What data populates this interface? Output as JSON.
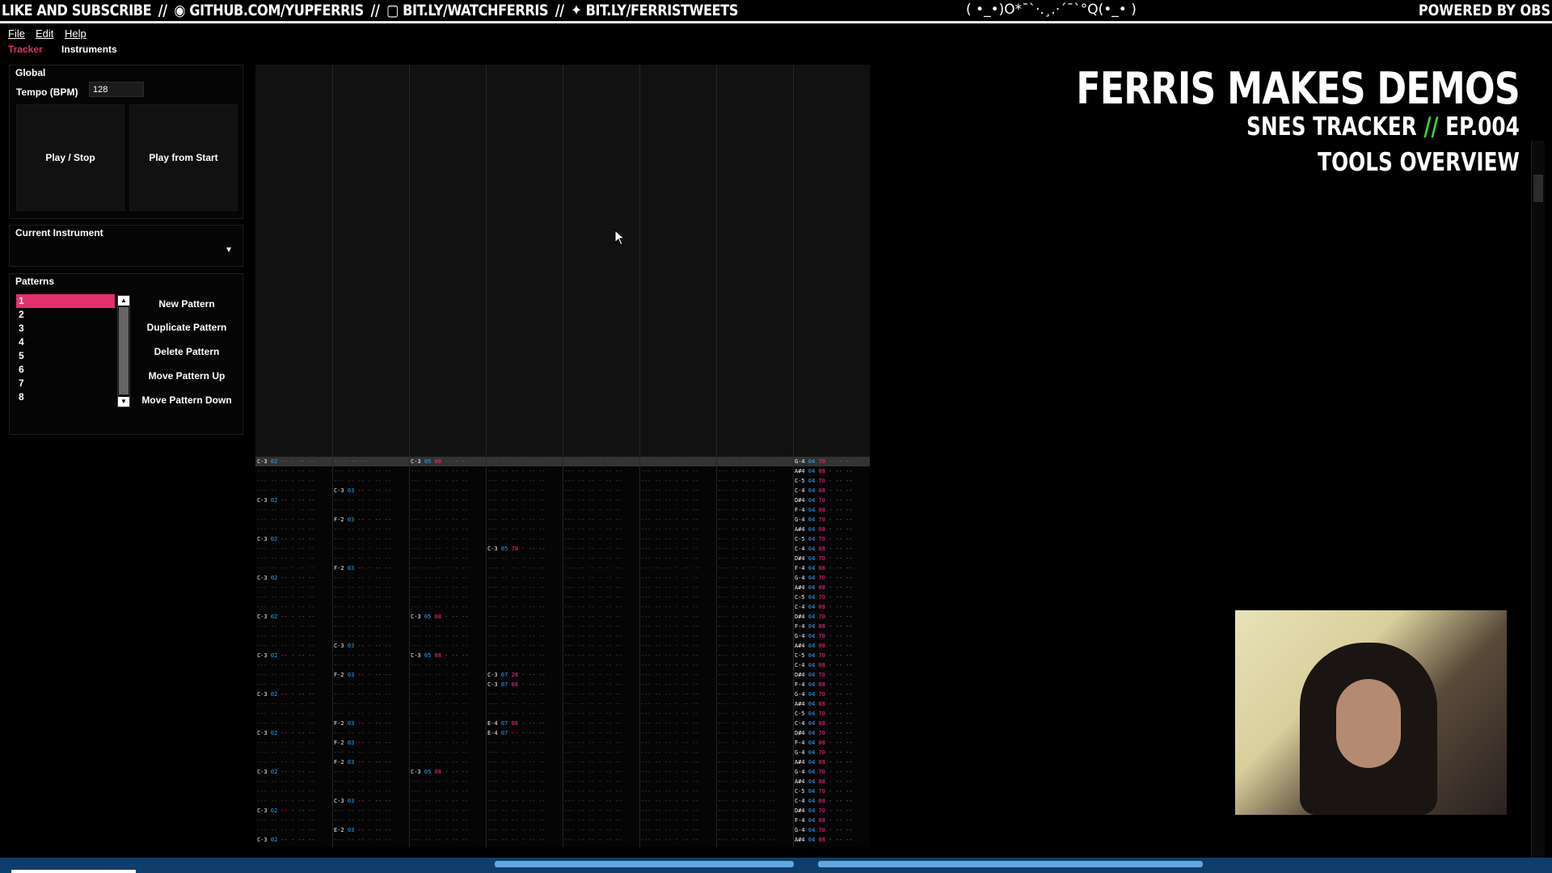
{
  "banner": {
    "left_1": "LIKE AND SUBSCRIBE",
    "left_2": "GITHUB.COM/YUPFERRIS",
    "left_3": "BIT.LY/WATCHFERRIS",
    "left_4": "BIT.LY/FERRISTWEETS",
    "separator": "//",
    "center": "( •_•)O*¯`·.¸.·´¯`°Q(•_• )",
    "right": "POWERED BY OBS"
  },
  "menu": [
    "File",
    "Edit",
    "Help"
  ],
  "tabs": [
    {
      "label": "Tracker",
      "active": true
    },
    {
      "label": "Instruments",
      "active": false
    }
  ],
  "global": {
    "title": "Global",
    "tempo_label": "Tempo (BPM)",
    "tempo_value": "128",
    "play_stop": "Play / Stop",
    "play_from_start": "Play from Start"
  },
  "instrument": {
    "title": "Current Instrument",
    "value": ""
  },
  "patterns": {
    "title": "Patterns",
    "items": [
      "1",
      "2",
      "3",
      "4",
      "5",
      "6",
      "7",
      "8"
    ],
    "selected": "1",
    "buttons": [
      "New Pattern",
      "Duplicate Pattern",
      "Delete Pattern",
      "Move Pattern Up",
      "Move Pattern Down"
    ]
  },
  "overlay": {
    "title": "FERRIS MAKES DEMOS",
    "subtitle_a": "SNES TRACKER",
    "subtitle_slash": "//",
    "subtitle_b": "EP.004",
    "subtitle_2": "TOOLS OVERVIEW"
  },
  "colors": {
    "accent": "#e4306a",
    "note": "#eeeeee",
    "instrument": "#2aa7ff",
    "volume": "#ff2a8a"
  },
  "tracker_rows": [
    {
      "hl": true,
      "cells": [
        [
          0,
          "C-3",
          "02",
          ""
        ],
        [
          1,
          "",
          "",
          ""
        ],
        [
          2,
          "C-3",
          "05",
          "08"
        ],
        [
          7,
          "G-4",
          "04",
          "70"
        ]
      ]
    },
    {
      "cells": [
        [
          7,
          "A#4",
          "04",
          "08"
        ]
      ]
    },
    {
      "cells": [
        [
          7,
          "C-5",
          "04",
          "70"
        ]
      ]
    },
    {
      "cells": [
        [
          1,
          "C-3",
          "03",
          ""
        ],
        [
          7,
          "C-4",
          "04",
          "08"
        ]
      ]
    },
    {
      "cells": [
        [
          0,
          "C-3",
          "02",
          ""
        ],
        [
          7,
          "D#4",
          "04",
          "70"
        ]
      ]
    },
    {
      "cells": [
        [
          7,
          "F-4",
          "04",
          "08"
        ]
      ]
    },
    {
      "cells": [
        [
          1,
          "F-2",
          "03",
          ""
        ],
        [
          7,
          "G-4",
          "04",
          "70"
        ]
      ]
    },
    {
      "cells": [
        [
          7,
          "A#4",
          "04",
          "08"
        ]
      ]
    },
    {
      "cells": [
        [
          0,
          "C-3",
          "02",
          ""
        ],
        [
          7,
          "C-5",
          "04",
          "70"
        ]
      ]
    },
    {
      "cells": [
        [
          3,
          "C-3",
          "05",
          "78"
        ],
        [
          7,
          "C-4",
          "04",
          "08"
        ]
      ]
    },
    {
      "cells": [
        [
          7,
          "D#4",
          "04",
          "70"
        ]
      ]
    },
    {
      "cells": [
        [
          1,
          "F-2",
          "03",
          ""
        ],
        [
          7,
          "F-4",
          "04",
          "08"
        ]
      ]
    },
    {
      "cells": [
        [
          0,
          "C-3",
          "02",
          ""
        ],
        [
          7,
          "G-4",
          "04",
          "70"
        ]
      ]
    },
    {
      "cells": [
        [
          7,
          "A#4",
          "04",
          "08"
        ]
      ]
    },
    {
      "cells": [
        [
          7,
          "C-5",
          "04",
          "70"
        ]
      ]
    },
    {
      "cells": [
        [
          7,
          "C-4",
          "04",
          "08"
        ]
      ]
    },
    {
      "cells": [
        [
          0,
          "C-3",
          "02",
          ""
        ],
        [
          2,
          "C-3",
          "05",
          "08"
        ],
        [
          7,
          "D#4",
          "04",
          "70"
        ]
      ]
    },
    {
      "cells": [
        [
          7,
          "F-4",
          "04",
          "08"
        ]
      ]
    },
    {
      "cells": [
        [
          7,
          "G-4",
          "04",
          "70"
        ]
      ]
    },
    {
      "cells": [
        [
          1,
          "C-3",
          "03",
          ""
        ],
        [
          7,
          "A#4",
          "04",
          "08"
        ]
      ]
    },
    {
      "cells": [
        [
          0,
          "C-3",
          "02",
          ""
        ],
        [
          2,
          "C-3",
          "05",
          "08"
        ],
        [
          7,
          "C-5",
          "04",
          "70"
        ]
      ]
    },
    {
      "cells": [
        [
          7,
          "C-4",
          "04",
          "08"
        ]
      ]
    },
    {
      "cells": [
        [
          1,
          "F-2",
          "03",
          ""
        ],
        [
          3,
          "C-3",
          "07",
          "28"
        ],
        [
          7,
          "D#4",
          "04",
          "70"
        ]
      ]
    },
    {
      "cells": [
        [
          3,
          "C-3",
          "07",
          "08"
        ],
        [
          7,
          "F-4",
          "04",
          "08"
        ]
      ]
    },
    {
      "cells": [
        [
          0,
          "C-3",
          "02",
          ""
        ],
        [
          7,
          "G-4",
          "04",
          "70"
        ]
      ]
    },
    {
      "cells": [
        [
          7,
          "A#4",
          "04",
          "08"
        ]
      ]
    },
    {
      "cells": [
        [
          7,
          "C-5",
          "04",
          "70"
        ]
      ]
    },
    {
      "cells": [
        [
          1,
          "F-2",
          "03",
          ""
        ],
        [
          3,
          "E-4",
          "07",
          "08"
        ],
        [
          7,
          "C-4",
          "04",
          "08"
        ]
      ]
    },
    {
      "cells": [
        [
          0,
          "C-3",
          "02",
          ""
        ],
        [
          3,
          "E-4",
          "07",
          ""
        ],
        [
          7,
          "D#4",
          "04",
          "70"
        ]
      ]
    },
    {
      "cells": [
        [
          1,
          "F-2",
          "03",
          ""
        ],
        [
          7,
          "F-4",
          "04",
          "08"
        ]
      ]
    },
    {
      "cells": [
        [
          7,
          "G-4",
          "04",
          "70"
        ]
      ]
    },
    {
      "cells": [
        [
          1,
          "F-2",
          "03",
          ""
        ],
        [
          7,
          "A#4",
          "04",
          "08"
        ]
      ]
    },
    {
      "cells": [
        [
          0,
          "C-3",
          "02",
          ""
        ],
        [
          2,
          "C-3",
          "05",
          "08"
        ],
        [
          7,
          "G-4",
          "04",
          "70"
        ]
      ]
    },
    {
      "cells": [
        [
          7,
          "A#4",
          "04",
          "08"
        ]
      ]
    },
    {
      "cells": [
        [
          7,
          "C-5",
          "04",
          "70"
        ]
      ]
    },
    {
      "cells": [
        [
          1,
          "C-3",
          "03",
          ""
        ],
        [
          7,
          "C-4",
          "04",
          "08"
        ]
      ]
    },
    {
      "cells": [
        [
          0,
          "C-3",
          "02",
          ""
        ],
        [
          7,
          "D#4",
          "04",
          "70"
        ]
      ]
    },
    {
      "cells": [
        [
          7,
          "F-4",
          "04",
          "08"
        ]
      ]
    },
    {
      "cells": [
        [
          1,
          "E-2",
          "03",
          ""
        ],
        [
          7,
          "G-4",
          "04",
          "70"
        ]
      ]
    },
    {
      "cells": [
        [
          0,
          "C-3",
          "02",
          ""
        ],
        [
          7,
          "A#4",
          "04",
          "08"
        ]
      ]
    }
  ]
}
